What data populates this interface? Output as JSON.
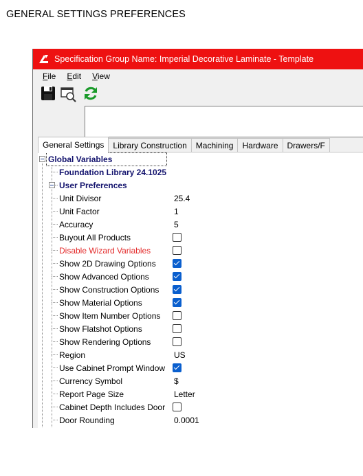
{
  "doc": {
    "title": "GENERAL SETTINGS PREFERENCES"
  },
  "window": {
    "title": "Specification Group Name: Imperial Decorative Laminate - Template",
    "menu": [
      "File",
      "Edit",
      "View"
    ]
  },
  "toolbar": {
    "icons": [
      "save-icon",
      "print-preview-icon",
      "refresh-icon"
    ]
  },
  "tabs": [
    "General Settings",
    "Library Construction",
    "Machining",
    "Hardware",
    "Drawers/F"
  ],
  "tree": {
    "global_variables": "Global Variables",
    "foundation_library": "Foundation Library 24.1025",
    "user_preferences": "User Preferences",
    "rows": [
      {
        "label": "Unit Divisor",
        "type": "text",
        "value": "25.4"
      },
      {
        "label": "Unit Factor",
        "type": "text",
        "value": "1"
      },
      {
        "label": "Accuracy",
        "type": "text",
        "value": "5"
      },
      {
        "label": "Buyout All Products",
        "type": "check",
        "checked": false
      },
      {
        "label": "Disable Wizard Variables",
        "type": "check",
        "checked": false,
        "color": "#e32b2b"
      },
      {
        "label": "Show 2D Drawing Options",
        "type": "check",
        "checked": true
      },
      {
        "label": "Show Advanced Options",
        "type": "check",
        "checked": true
      },
      {
        "label": "Show Construction Options",
        "type": "check",
        "checked": true
      },
      {
        "label": "Show Material Options",
        "type": "check",
        "checked": true
      },
      {
        "label": "Show Item Number Options",
        "type": "check",
        "checked": false
      },
      {
        "label": "Show Flatshot Options",
        "type": "check",
        "checked": false
      },
      {
        "label": "Show Rendering Options",
        "type": "check",
        "checked": false
      },
      {
        "label": "Region",
        "type": "text",
        "value": "US"
      },
      {
        "label": "Use Cabinet Prompt Window",
        "type": "check",
        "checked": true
      },
      {
        "label": "Currency Symbol",
        "type": "text",
        "value": "$"
      },
      {
        "label": "Report Page Size",
        "type": "text",
        "value": "Letter"
      },
      {
        "label": "Cabinet Depth Includes Door",
        "type": "check",
        "checked": false
      },
      {
        "label": "Door Rounding",
        "type": "text",
        "value": "0.0001"
      }
    ]
  },
  "colors": {
    "titlebar": "#ee1111",
    "section_text": "#14146e",
    "check_on": "#0a5fce",
    "warning_text": "#e32b2b"
  }
}
